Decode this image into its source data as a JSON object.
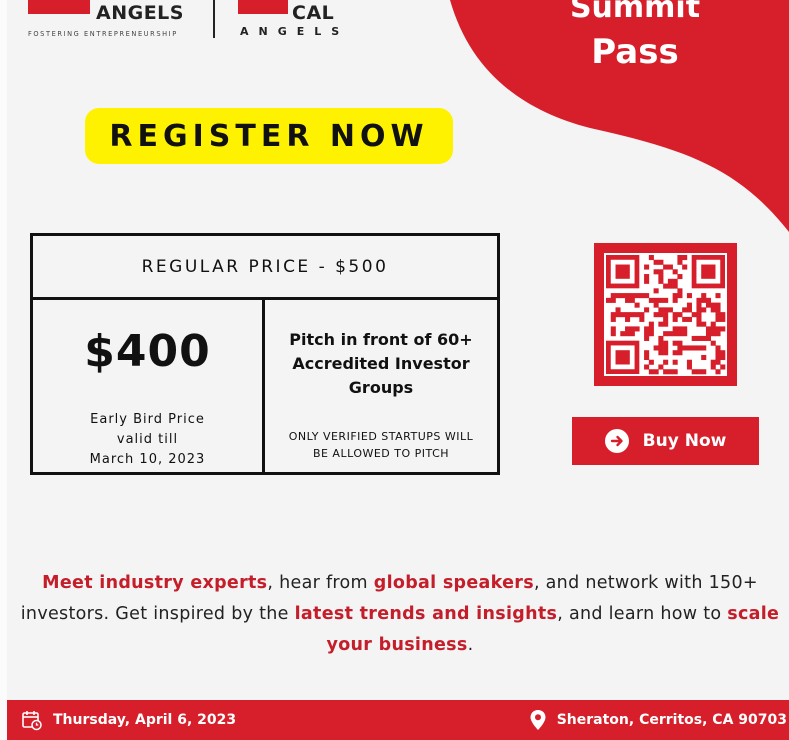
{
  "branding": {
    "left_logo_word": "ANGELS",
    "left_logo_tagline": "FOSTERING ENTREPRENEURSHIP",
    "right_logo_word": "CAL",
    "right_logo_sub": "ANGELS"
  },
  "hero": {
    "line1": "Summit",
    "line2": "Pass"
  },
  "register_label": "REGISTER NOW",
  "pricing": {
    "regular_price": "REGULAR PRICE - $500",
    "early_price": "$400",
    "early_desc_1": "Early Bird Price",
    "early_desc_2": "valid till",
    "early_desc_3": "March 10, 2023",
    "pitch_1": "Pitch in front of 60+",
    "pitch_2": "Accredited Investor",
    "pitch_3": "Groups",
    "pitch_note_1": "ONLY VERIFIED STARTUPS WILL",
    "pitch_note_2": "BE ALLOWED TO PITCH"
  },
  "buy_button": {
    "label": "Buy Now",
    "icon": "arrow-circle-right-icon"
  },
  "tagline": {
    "p1": "Meet industry experts",
    "p2": ", hear from ",
    "p3": "global speakers",
    "p4": ", and network with 150+ investors. Get inspired by the ",
    "p5": "latest trends and insights",
    "p6": ", and learn how to ",
    "p7": "scale your business",
    "p8": "."
  },
  "footer": {
    "date": "Thursday, April 6, 2023",
    "location": "Sheraton, Cerritos, CA 90703",
    "date_icon": "calendar-clock-icon",
    "location_icon": "map-pin-icon"
  },
  "colors": {
    "brand_red": "#d71f2b",
    "highlight_yellow": "#fff200",
    "background": "#f4f4f4"
  }
}
